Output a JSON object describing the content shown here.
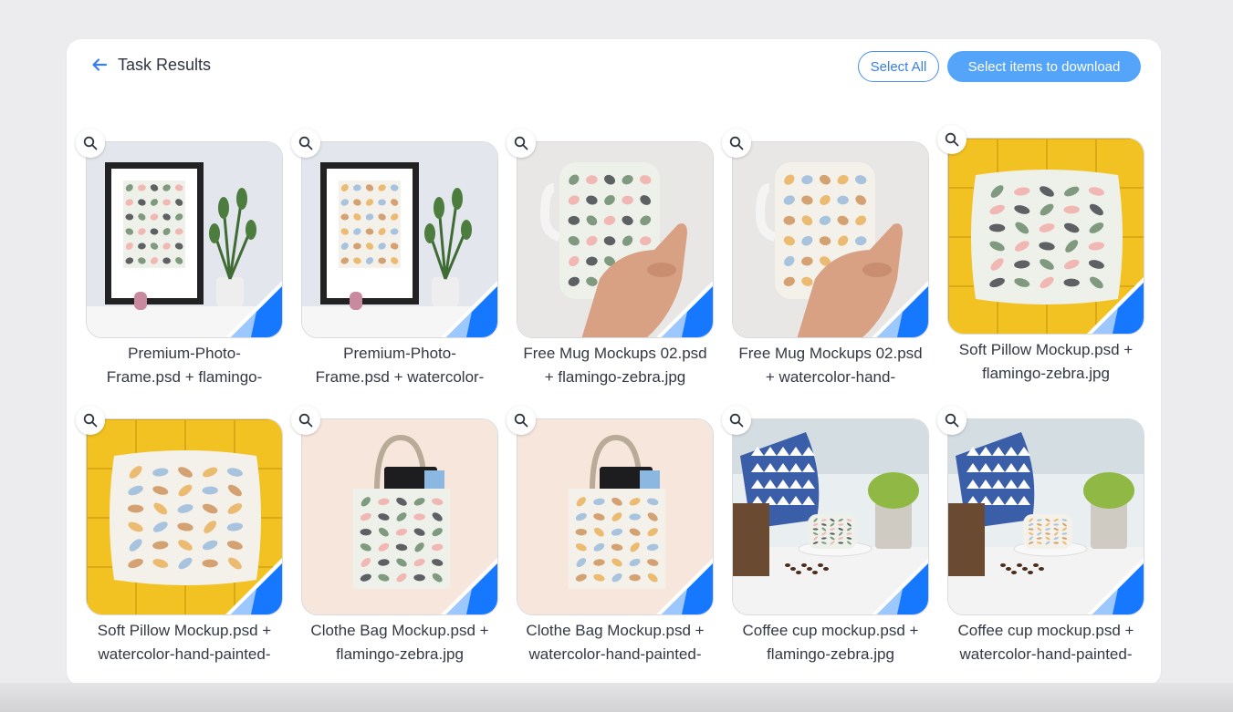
{
  "header": {
    "title": "Task Results",
    "select_all_label": "Select All",
    "download_label": "Select items to download"
  },
  "colors": {
    "accent": "#3a7fe6",
    "download_button": "#54a5fa",
    "corner_dark": "#1677ff",
    "corner_light": "#9cc8ff"
  },
  "items": [
    {
      "line1": "Premium-Photo-",
      "line2": "Frame.psd + flamingo-",
      "scene": "frame",
      "pattern": "flamingo"
    },
    {
      "line1": "Premium-Photo-",
      "line2": "Frame.psd + watercolor-",
      "scene": "frame",
      "pattern": "watercolor"
    },
    {
      "line1": "Free Mug Mockups 02.psd",
      "line2": "+ flamingo-zebra.jpg",
      "scene": "mug",
      "pattern": "flamingo"
    },
    {
      "line1": "Free Mug Mockups 02.psd",
      "line2": "+ watercolor-hand-",
      "scene": "mug",
      "pattern": "watercolor"
    },
    {
      "line1": "Soft Pillow Mockup.psd +",
      "line2": "flamingo-zebra.jpg",
      "scene": "pillow",
      "pattern": "flamingo"
    },
    {
      "line1": "Soft Pillow Mockup.psd +",
      "line2": "watercolor-hand-painted-",
      "scene": "pillow",
      "pattern": "watercolor"
    },
    {
      "line1": "Clothe Bag Mockup.psd +",
      "line2": "flamingo-zebra.jpg",
      "scene": "bag",
      "pattern": "flamingo"
    },
    {
      "line1": "Clothe Bag Mockup.psd +",
      "line2": "watercolor-hand-painted-",
      "scene": "bag",
      "pattern": "watercolor"
    },
    {
      "line1": "Coffee cup mockup.psd +",
      "line2": "flamingo-zebra.jpg",
      "scene": "coffee",
      "pattern": "flamingo"
    },
    {
      "line1": "Coffee cup mockup.psd +",
      "line2": "watercolor-hand-painted-",
      "scene": "coffee",
      "pattern": "watercolor"
    }
  ]
}
